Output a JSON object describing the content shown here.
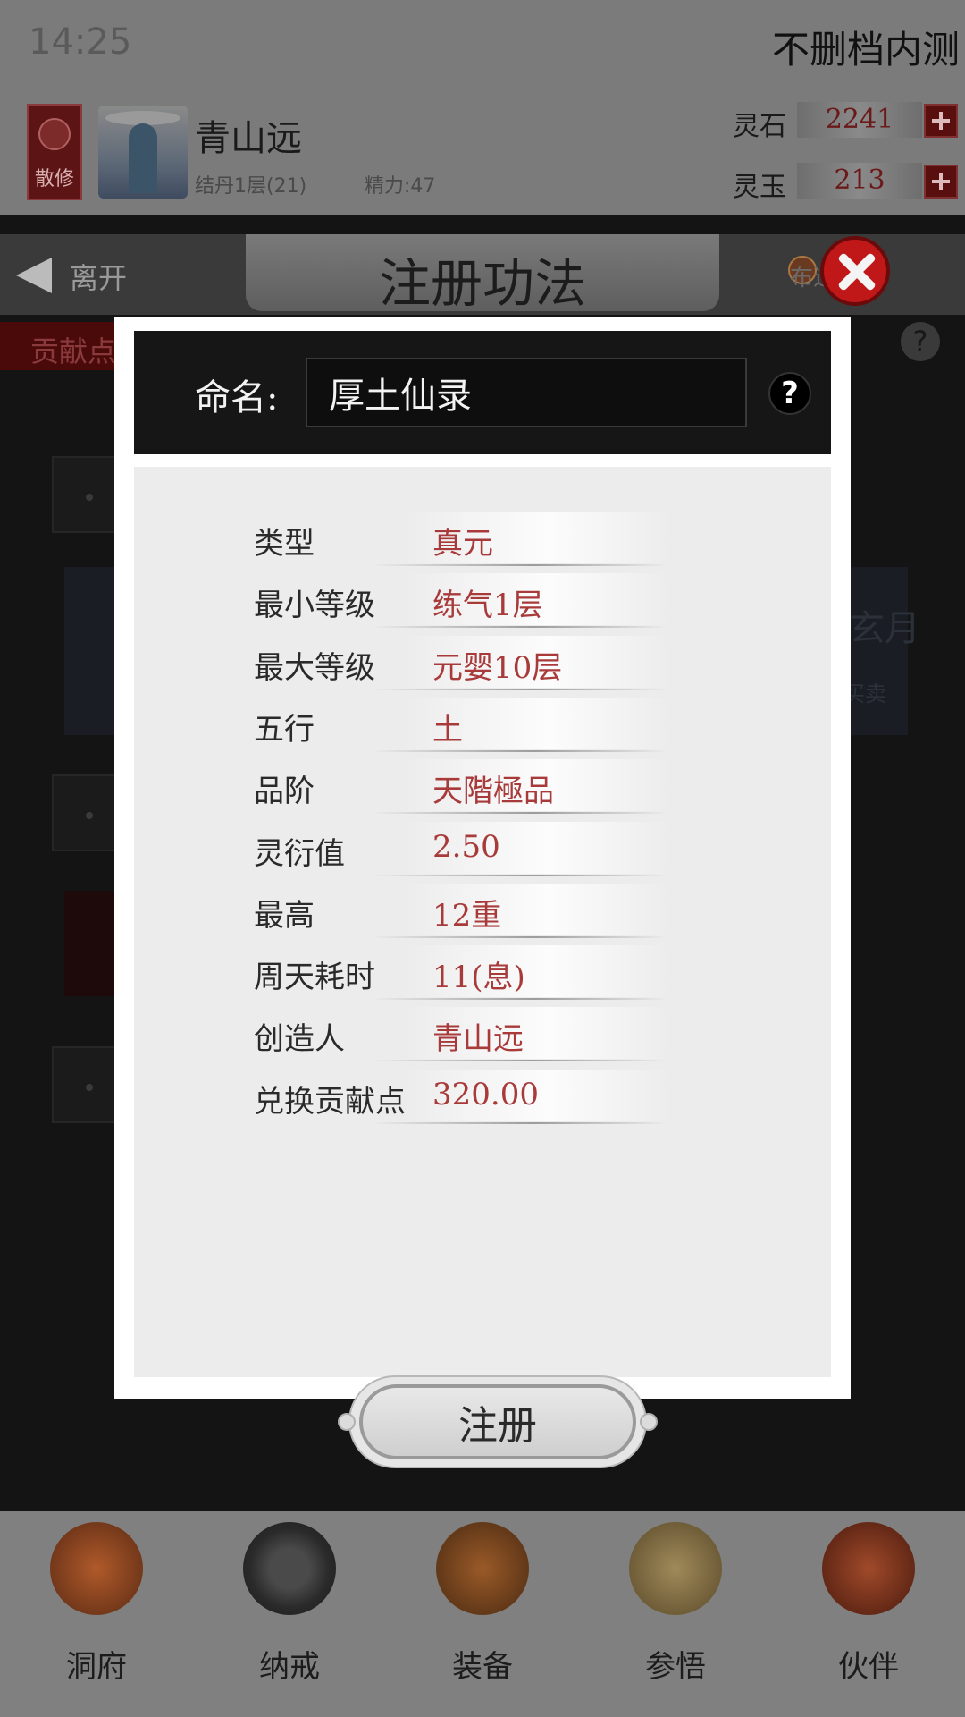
{
  "status_bar": {
    "time": "14:25",
    "build_label": "不删档内测"
  },
  "player": {
    "sect_badge": "散修",
    "name": "青山远",
    "rank": "结丹1层(21)",
    "energy": "精力:47",
    "currencies": [
      {
        "label": "灵石",
        "value": "2241"
      },
      {
        "label": "灵玉",
        "value": "213"
      }
    ]
  },
  "header": {
    "title": "注册功法",
    "leave_label": "离开",
    "right_nav_label": "布道】"
  },
  "background": {
    "tab_label": "贡献点",
    "panel_title": "玄月",
    "panel_sub": "买卖",
    "help": "?"
  },
  "dialog": {
    "name_label": "命名:",
    "name_value": "厚土仙录",
    "help_glyph": "?",
    "rows": [
      {
        "key": "类型",
        "value": "真元"
      },
      {
        "key": "最小等级",
        "value": "练气1层"
      },
      {
        "key": "最大等级",
        "value": "元婴10层"
      },
      {
        "key": "五行",
        "value": "土"
      },
      {
        "key": "品阶",
        "value": "天階極品"
      },
      {
        "key": "灵衍值",
        "value": "2.50"
      },
      {
        "key": "最高",
        "value": "12重"
      },
      {
        "key": "周天耗时",
        "value": "11(息)"
      },
      {
        "key": "创造人",
        "value": "青山远"
      },
      {
        "key": "兑换贡献点",
        "value": "320.00"
      }
    ],
    "register_label": "注册"
  },
  "bottom_nav": [
    {
      "label": "洞府",
      "icon": "cave-mansion-icon",
      "color": "#7a3a1e"
    },
    {
      "label": "纳戒",
      "icon": "storage-ring-icon",
      "color": "#2e2e2e"
    },
    {
      "label": "装备",
      "icon": "helmet-icon",
      "color": "#6a3e1c"
    },
    {
      "label": "参悟",
      "icon": "scroll-icon",
      "color": "#6a5a3a"
    },
    {
      "label": "伙伴",
      "icon": "companion-icon",
      "color": "#6a2a1a"
    }
  ]
}
